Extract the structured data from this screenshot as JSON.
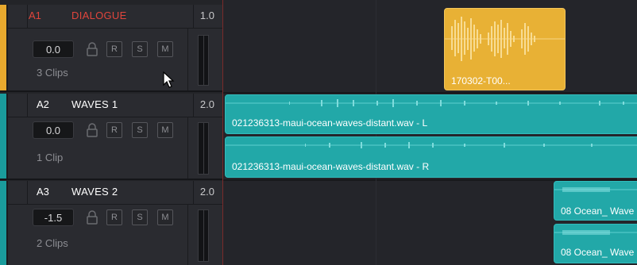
{
  "colors": {
    "a1_accent": "#e8a92e",
    "a2_accent": "#1a9c9c",
    "a1_clip": "#e8b135",
    "teal_clip": "#22a8a8",
    "a1_text": "#e0453c",
    "white_text": "#ffffff"
  },
  "tracks": [
    {
      "id": "A1",
      "name": "DIALOGUE",
      "ratio": "1.0",
      "volume": "0.0",
      "clips": "3 Clips",
      "buttons": [
        "R",
        "S",
        "M"
      ]
    },
    {
      "id": "A2",
      "name": "WAVES 1",
      "ratio": "2.0",
      "volume": "0.0",
      "clips": "1 Clip",
      "buttons": [
        "R",
        "S",
        "M"
      ]
    },
    {
      "id": "A3",
      "name": "WAVES 2",
      "ratio": "2.0",
      "volume": "-1.5",
      "clips": "2 Clips",
      "buttons": [
        "R",
        "S",
        "M"
      ]
    }
  ],
  "clips": {
    "dialogue": "170302-T00...",
    "waves1_L": "021236313-maui-ocean-waves-distant.wav - L",
    "waves1_R": "021236313-maui-ocean-waves-distant.wav - R",
    "waves2_a": "08 Ocean_ Wave",
    "waves2_b": "08 Ocean_ Wave"
  },
  "icons": [
    "lock-icon",
    "mouse-pointer-icon"
  ]
}
